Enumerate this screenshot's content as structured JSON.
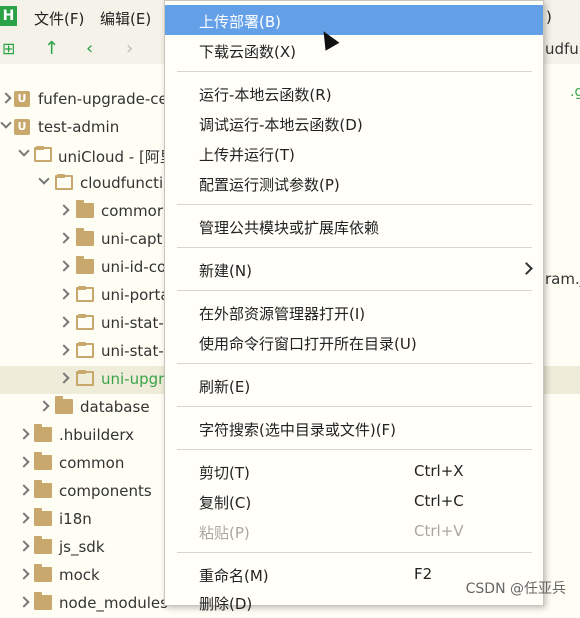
{
  "menubar": {
    "logo": "H",
    "file": "文件(F)",
    "edit": "编辑(E)",
    "partial_right": ")"
  },
  "toolbar": {
    "back": "←",
    "forward": "→",
    "up": "↑",
    "partial_text": "udfu"
  },
  "tree": {
    "items": [
      {
        "label": "fufen-upgrade-ce"
      },
      {
        "label": "test-admin"
      },
      {
        "label": "uniCloud - [阿里",
        "suffix_color": "#c07a3a"
      },
      {
        "label": "cloudfuncti"
      },
      {
        "label": "commor"
      },
      {
        "label": "uni-capt"
      },
      {
        "label": "uni-id-co"
      },
      {
        "label": "uni-porta"
      },
      {
        "label": "uni-stat-"
      },
      {
        "label": "uni-stat-"
      },
      {
        "label": "uni-upgr"
      },
      {
        "label": "database"
      },
      {
        "label": ".hbuilderx"
      },
      {
        "label": "common"
      },
      {
        "label": "components"
      },
      {
        "label": "i18n"
      },
      {
        "label": "js_sdk"
      },
      {
        "label": "mock"
      },
      {
        "label": "node_modules"
      }
    ],
    "side_text_1": ".g",
    "side_text_2": "ram.j"
  },
  "context_menu": {
    "items": [
      {
        "label": "上传部署(B)",
        "highlight": true
      },
      {
        "label": "下载云函数(X)"
      },
      {
        "label": "运行-本地云函数(R)"
      },
      {
        "label": "调试运行-本地云函数(D)"
      },
      {
        "label": "上传并运行(T)"
      },
      {
        "label": "配置运行测试参数(P)"
      },
      {
        "label": "管理公共模块或扩展库依赖"
      },
      {
        "label": "新建(N)",
        "submenu": true
      },
      {
        "label": "在外部资源管理器打开(I)"
      },
      {
        "label": "使用命令行窗口打开所在目录(U)"
      },
      {
        "label": "刷新(E)"
      },
      {
        "label": "字符搜索(选中目录或文件)(F)"
      },
      {
        "label": "剪切(T)",
        "shortcut": "Ctrl+X"
      },
      {
        "label": "复制(C)",
        "shortcut": "Ctrl+C"
      },
      {
        "label": "粘贴(P)",
        "shortcut": "Ctrl+V",
        "disabled": true
      },
      {
        "label": "重命名(M)",
        "shortcut": "F2"
      },
      {
        "label": "删除(D)"
      }
    ]
  },
  "watermark": "CSDN @任亚兵",
  "colors": {
    "highlight": "#63a0e8",
    "folder": "#c8a86c",
    "logo": "#2ba245"
  }
}
